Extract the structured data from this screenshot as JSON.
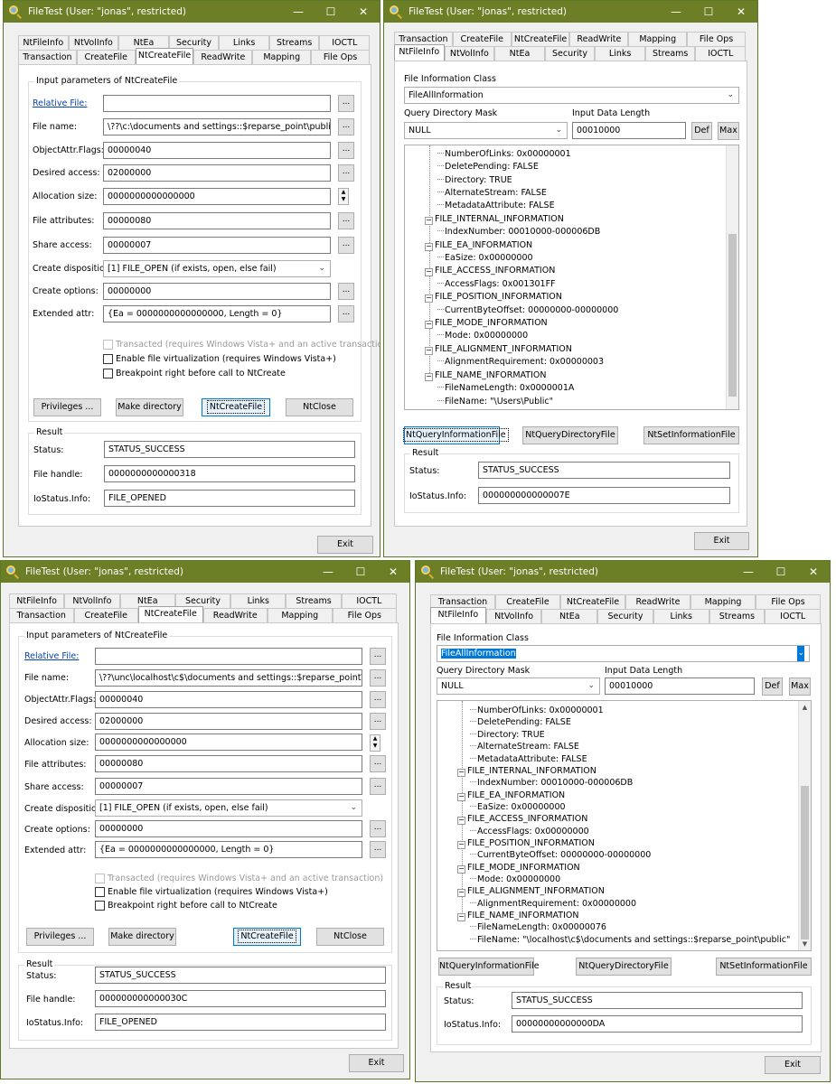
{
  "title": "FileTest (User: \"jonas\", restricted)",
  "controls": {
    "minimize": "—",
    "maximize": "☐",
    "close": "✕"
  },
  "tabs_row1": [
    "NtFileInfo",
    "NtVolInfo",
    "NtEa",
    "Security",
    "Links",
    "Streams",
    "IOCTL"
  ],
  "tabs_row2": [
    "Transaction",
    "CreateFile",
    "NtCreateFile",
    "ReadWrite",
    "Mapping",
    "File Ops"
  ],
  "create": {
    "group": "Input parameters of NtCreateFile",
    "labels": {
      "relative": "Relative File:",
      "filename": "File name:",
      "objattr": "ObjectAttr.Flags:",
      "access": "Desired access:",
      "alloc": "Allocation size:",
      "attrs": "File attributes:",
      "share": "Share access:",
      "disp": "Create disposition:",
      "options": "Create options:",
      "ext": "Extended attr:"
    },
    "values": {
      "objattr": "00000040",
      "access": "02000000",
      "alloc": "0000000000000000",
      "attrs": "00000080",
      "share": "00000007",
      "disp": "[1] FILE_OPEN (if exists, open, else fail)",
      "options": "00000000",
      "ext": "{Ea = 0000000000000000, Length = 0}"
    },
    "dots": "...",
    "chk_transacted": "Transacted (requires Windows Vista+ and an active transaction)",
    "chk_virtual": "Enable file virtualization (requires Windows Vista+)",
    "chk_break": "Breakpoint right before call to NtCreate",
    "btn_priv": "Privileges ...",
    "btn_mkdir": "Make directory",
    "btn_create": "NtCreateFile",
    "btn_close": "NtClose",
    "result": "Result",
    "status_label": "Status:",
    "handle_label": "File handle:",
    "io_label": "IoStatus.Info:",
    "status": "STATUS_SUCCESS",
    "io": "FILE_OPENED",
    "exit": "Exit"
  },
  "win1": {
    "filename": "\\??\\c:\\documents and settings::$reparse_point\\public",
    "handle": "0000000000000318"
  },
  "win3": {
    "filename": "\\??\\unc\\localhost\\c$\\documents and settings::$reparse_point\\public",
    "handle": "000000000000030C"
  },
  "info": {
    "class_label": "File Information Class",
    "class_value": "FileAllInformation",
    "mask_label": "Query Directory Mask",
    "mask_value": "NULL",
    "length_label": "Input Data Length",
    "length_value": "00010000",
    "btn_def": "Def",
    "btn_max": "Max",
    "tree_common": [
      "NumberOfLinks: 0x00000001",
      "DeletePending: FALSE",
      "Directory: TRUE",
      "AlternateStream: FALSE",
      "MetadataAttribute: FALSE",
      "FILE_INTERNAL_INFORMATION",
      "IndexNumber: 00010000-000006DB",
      "FILE_EA_INFORMATION",
      "EaSize: 0x00000000",
      "FILE_ACCESS_INFORMATION"
    ],
    "tree_tail": [
      "FILE_POSITION_INFORMATION",
      "CurrentByteOffset: 00000000-00000000",
      "FILE_MODE_INFORMATION",
      "Mode: 0x00000000",
      "FILE_ALIGNMENT_INFORMATION",
      "FILE_NAME_INFORMATION"
    ],
    "btn_query": "NtQueryInformationFile",
    "btn_dir": "NtQueryDirectoryFile",
    "btn_set": "NtSetInformationFile",
    "result": "Result",
    "status_label": "Status:",
    "io_label": "IoStatus.Info:",
    "status": "STATUS_SUCCESS",
    "exit": "Exit"
  },
  "win2": {
    "access_flags": "AccessFlags: 0x001301FF",
    "alignment": "AlignmentRequirement: 0x00000003",
    "name_length": "FileNameLength: 0x0000001A",
    "file_name": "FileName: \"\\Users\\Public\"",
    "io": "000000000000007E"
  },
  "win4": {
    "access_flags": "AccessFlags: 0x00000000",
    "alignment": "AlignmentRequirement: 0x00000000",
    "name_length": "FileNameLength: 0x00000076",
    "file_name": "FileName: \"\\localhost\\c$\\documents and settings::$reparse_point\\public\"",
    "io": "00000000000000DA"
  }
}
